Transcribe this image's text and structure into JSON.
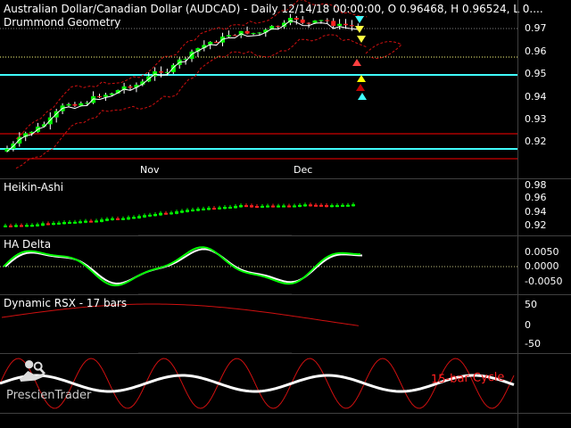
{
  "header": {
    "symbol_info": "Australian Dollar/Canadian Dollar (AUDCAD) - Daily 12/14/18 00:00:00, O 0.96468, H 0.96524, L 0...."
  },
  "panes": {
    "main": {
      "label": "Drummond Geometry",
      "y_ticks": [
        "0.97",
        "0.96",
        "0.95",
        "0.94",
        "0.93",
        "0.92"
      ]
    },
    "heikin": {
      "label": "Heikin-Ashi",
      "y_ticks": [
        "0.98",
        "0.96",
        "0.94",
        "0.92"
      ]
    },
    "ha_delta": {
      "label": "HA Delta",
      "y_ticks": [
        "0.0050",
        "0.0000",
        "-0.0050"
      ]
    },
    "rsx": {
      "label": "Dynamic RSX - 17 bars",
      "y_ticks": [
        "50",
        "0",
        "-50"
      ]
    },
    "cycle": {
      "label": "15-bar Cycle"
    }
  },
  "x_axis": {
    "labels": [
      "Nov",
      "Dec"
    ]
  },
  "logo": {
    "text": "PrescienTrader",
    "icon": "reader-icon"
  },
  "colors": {
    "bull": "#00ff00",
    "bear": "#ff2020",
    "level_line": "#ff0000",
    "support_line": "#40ffff",
    "cycle_line": "#ffffff"
  }
}
